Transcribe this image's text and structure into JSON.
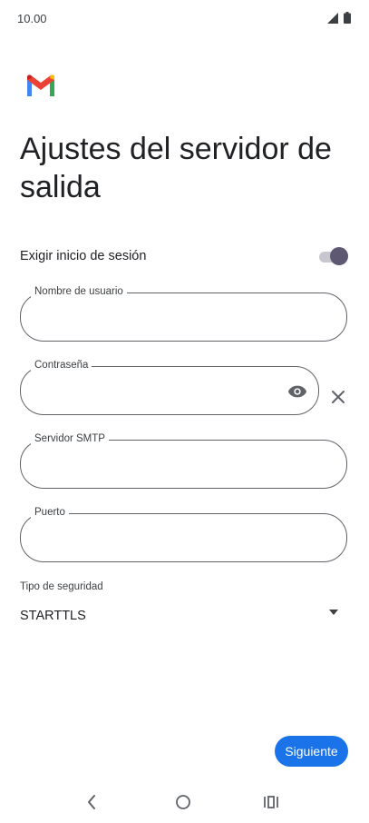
{
  "status_bar": {
    "time": "10.00",
    "icons": [
      "signal-icon",
      "battery-icon"
    ]
  },
  "app": {
    "logo": "gmail-logo"
  },
  "page": {
    "title": "Ajustes del servidor de salida"
  },
  "login_toggle": {
    "label": "Exigir inicio de sesión",
    "enabled": true
  },
  "fields": {
    "username": {
      "label": "Nombre de usuario",
      "value": ""
    },
    "password": {
      "label": "Contraseña",
      "value": ""
    },
    "smtp_server": {
      "label": "Servidor SMTP",
      "value": ""
    },
    "port": {
      "label": "Puerto",
      "value": ""
    }
  },
  "security": {
    "label": "Tipo de seguridad",
    "selected": "STARTTLS"
  },
  "buttons": {
    "next": "Siguiente"
  },
  "nav": {
    "items": [
      "back-icon",
      "home-icon",
      "recents-icon"
    ]
  },
  "colors": {
    "accent": "#1a73e8",
    "toggle_thumb": "#5e5873",
    "toggle_track": "#c8c6cf",
    "outline": "#606368"
  }
}
